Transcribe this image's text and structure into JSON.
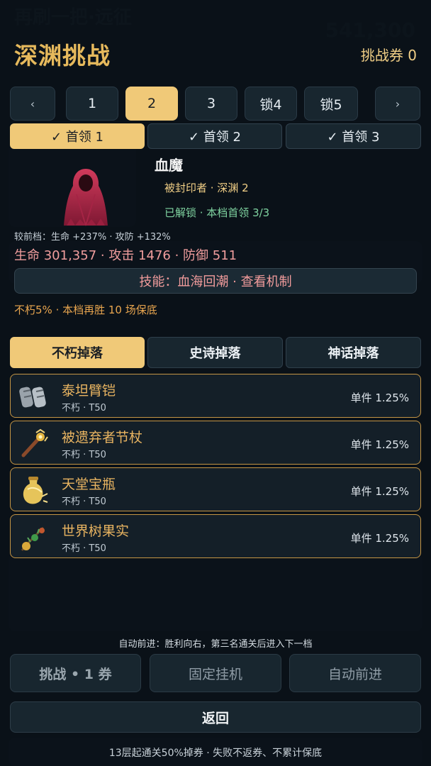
{
  "background": {
    "title": "再刷一把·远征",
    "score": "541,300"
  },
  "header": {
    "title": "深渊挑战",
    "ticket_label": "挑战券 0"
  },
  "tiers": [
    {
      "label": "‹",
      "kind": "arrow"
    },
    {
      "label": "1",
      "kind": "tier"
    },
    {
      "label": "2",
      "kind": "tier",
      "active": true
    },
    {
      "label": "3",
      "kind": "tier"
    },
    {
      "label": "锁4",
      "kind": "tier"
    },
    {
      "label": "锁5",
      "kind": "tier"
    },
    {
      "label": "›",
      "kind": "arrow"
    }
  ],
  "boss_tabs": [
    {
      "label": "✓ 首领 1",
      "active": true
    },
    {
      "label": "✓ 首领 2"
    },
    {
      "label": "✓ 首领 3"
    }
  ],
  "boss": {
    "name": "血魔",
    "subtitle": "被封印者 · 深渊 2",
    "unlock": "已解锁 · 本档首领 3/3",
    "compare": "较前档：生命 +237% · 攻防 +132%",
    "stats": "生命 301,357 · 攻击 1476 · 防御 511",
    "skill": "技能：血海回潮 · 查看机制",
    "pity": "不朽5% · 本档再胜 10 场保底"
  },
  "drop_tabs": [
    {
      "label": "不朽掉落",
      "active": true
    },
    {
      "label": "史诗掉落"
    },
    {
      "label": "神话掉落"
    }
  ],
  "loot": [
    {
      "name": "泰坦臂铠",
      "sub": "不朽 · T50",
      "rate": "单件 1.25%",
      "icon": "bracer-icon"
    },
    {
      "name": "被遗弃者节杖",
      "sub": "不朽 · T50",
      "rate": "单件 1.25%",
      "icon": "scepter-icon"
    },
    {
      "name": "天堂宝瓶",
      "sub": "不朽 · T50",
      "rate": "单件 1.25%",
      "icon": "vial-icon"
    },
    {
      "name": "世界树果实",
      "sub": "不朽 · T50",
      "rate": "单件 1.25%",
      "icon": "fruit-icon"
    }
  ],
  "auto_hint": "自动前进：胜利向右，第三名通关后进入下一档",
  "actions": {
    "challenge": "挑战 • 1 券",
    "fixed": "固定挂机",
    "auto": "自动前进"
  },
  "back": "返回",
  "footer": "13层起通关50%掉券 · 失败不返券、不累计保底",
  "colors": {
    "accent": "#f0c978",
    "title": "#e6b95c",
    "legendary_border": "#c49545",
    "stat_red": "#f09d9d",
    "unlock_green": "#7fd3a0"
  }
}
